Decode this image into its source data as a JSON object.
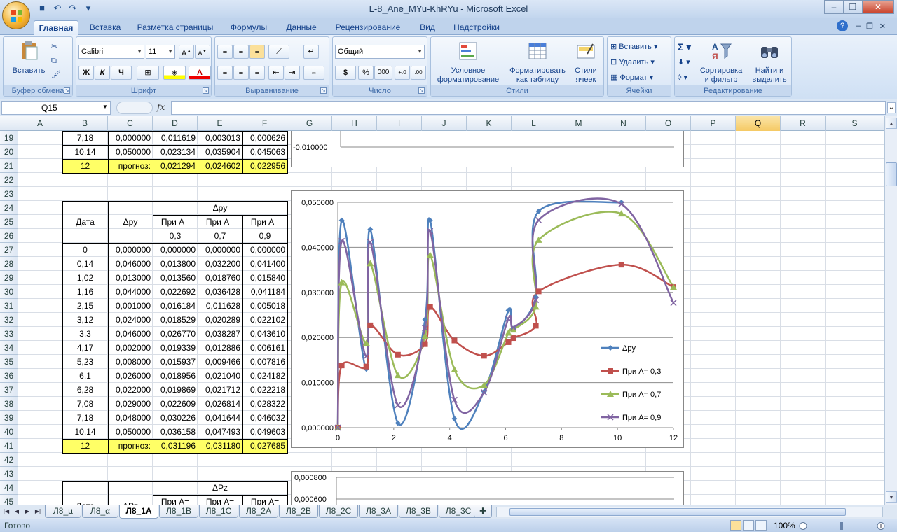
{
  "window": {
    "title": "L-8_Ane_MYu-KhRYu - Microsoft Excel"
  },
  "ribbon_tabs": [
    "Главная",
    "Вставка",
    "Разметка страницы",
    "Формулы",
    "Данные",
    "Рецензирование",
    "Вид",
    "Надстройки"
  ],
  "ribbon": {
    "clipboard": {
      "label": "Буфер обмена",
      "paste": "Вставить"
    },
    "font": {
      "label": "Шрифт",
      "name": "Calibri",
      "size": "11",
      "bold": "Ж",
      "italic": "К",
      "underline": "Ч"
    },
    "alignment": {
      "label": "Выравнивание"
    },
    "number": {
      "label": "Число",
      "format": "Общий",
      "currency": "$",
      "percent": "%",
      "thousands": "000"
    },
    "styles": {
      "label": "Стили",
      "conditional_1": "Условное",
      "conditional_2": "форматирование",
      "table_1": "Форматировать",
      "table_2": "как таблицу",
      "cell_1": "Стили",
      "cell_2": "ячеек"
    },
    "cells": {
      "label": "Ячейки",
      "insert": "Вставить",
      "delete": "Удалить",
      "format": "Формат"
    },
    "editing": {
      "label": "Редактирование",
      "sort_1": "Сортировка",
      "sort_2": "и фильтр",
      "find_1": "Найти и",
      "find_2": "выделить"
    }
  },
  "formula_bar": {
    "name_box": "Q15",
    "fx": "fx",
    "value": ""
  },
  "columns": [
    "A",
    "B",
    "C",
    "D",
    "E",
    "F",
    "G",
    "H",
    "I",
    "J",
    "K",
    "L",
    "M",
    "N",
    "O",
    "P",
    "Q",
    "R",
    "S"
  ],
  "rows": [
    "19",
    "20",
    "21",
    "22",
    "23",
    "24",
    "25",
    "26",
    "27",
    "28",
    "29",
    "30",
    "31",
    "32",
    "33",
    "34",
    "35",
    "36",
    "37",
    "38",
    "39",
    "40",
    "41",
    "42",
    "43",
    "44",
    "45"
  ],
  "top_table": {
    "rows": [
      [
        "7,18",
        "0,000000",
        "0,011619",
        "0,003013",
        "0,000626"
      ],
      [
        "10,14",
        "0,050000",
        "0,023134",
        "0,035904",
        "0,045063"
      ]
    ],
    "forecast": [
      "12",
      "прогноз:",
      "0,021294",
      "0,024602",
      "0,022956"
    ]
  },
  "table_py": {
    "h_date": "Дата",
    "h_delta": "Δpy",
    "h_group": "Δpy",
    "h_a1": "При А=",
    "h_a1v": "0,3",
    "h_a2": "При А=",
    "h_a2v": "0,7",
    "h_a3": "При А=",
    "h_a3v": "0,9",
    "rows": [
      [
        "0",
        "0,000000",
        "0,000000",
        "0,000000",
        "0,000000"
      ],
      [
        "0,14",
        "0,046000",
        "0,013800",
        "0,032200",
        "0,041400"
      ],
      [
        "1,02",
        "0,013000",
        "0,013560",
        "0,018760",
        "0,015840"
      ],
      [
        "1,16",
        "0,044000",
        "0,022692",
        "0,036428",
        "0,041184"
      ],
      [
        "2,15",
        "0,001000",
        "0,016184",
        "0,011628",
        "0,005018"
      ],
      [
        "3,12",
        "0,024000",
        "0,018529",
        "0,020289",
        "0,022102"
      ],
      [
        "3,3",
        "0,046000",
        "0,026770",
        "0,038287",
        "0,043610"
      ],
      [
        "4,17",
        "0,002000",
        "0,019339",
        "0,012886",
        "0,006161"
      ],
      [
        "5,23",
        "0,008000",
        "0,015937",
        "0,009466",
        "0,007816"
      ],
      [
        "6,1",
        "0,026000",
        "0,018956",
        "0,021040",
        "0,024182"
      ],
      [
        "6,28",
        "0,022000",
        "0,019869",
        "0,021712",
        "0,022218"
      ],
      [
        "7,08",
        "0,029000",
        "0,022609",
        "0,026814",
        "0,028322"
      ],
      [
        "7,18",
        "0,048000",
        "0,030226",
        "0,041644",
        "0,046032"
      ],
      [
        "10,14",
        "0,050000",
        "0,036158",
        "0,047493",
        "0,049603"
      ]
    ],
    "forecast": [
      "12",
      "прогноз:",
      "0,031196",
      "0,031180",
      "0,027685"
    ]
  },
  "table_pz": {
    "h_date": "Дата",
    "h_delta": "ΔPz",
    "h_group": "ΔPz",
    "h_a1": "При А=",
    "h_a2": "При А=",
    "h_a3": "При А="
  },
  "top_chart": {
    "tick": "-0,010000"
  },
  "bottom_chart": {
    "ticks": [
      "0,000800",
      "0,000600"
    ]
  },
  "chart_data": {
    "type": "scatter",
    "x": [
      0,
      0.14,
      1.02,
      1.16,
      2.15,
      3.12,
      3.3,
      4.17,
      5.23,
      6.1,
      6.28,
      7.08,
      7.18,
      10.14,
      12
    ],
    "series": [
      {
        "name": "Δpy",
        "color": "#4f81bd",
        "marker": "diamond",
        "values": [
          0,
          0.046,
          0.013,
          0.044,
          0.001,
          0.024,
          0.046,
          0.002,
          0.008,
          0.026,
          0.022,
          0.029,
          0.048,
          0.05,
          null
        ]
      },
      {
        "name": "При А= 0,3",
        "color": "#c0504d",
        "marker": "square",
        "values": [
          0,
          0.0138,
          0.01356,
          0.022692,
          0.016184,
          0.018529,
          0.02677,
          0.019339,
          0.015937,
          0.018956,
          0.019869,
          0.022609,
          0.030226,
          0.036158,
          0.031196
        ]
      },
      {
        "name": "При А= 0,7",
        "color": "#9bbb59",
        "marker": "triangle",
        "values": [
          0,
          0.0322,
          0.01876,
          0.036428,
          0.011628,
          0.020289,
          0.038287,
          0.012886,
          0.009466,
          0.02104,
          0.021712,
          0.026814,
          0.041644,
          0.047493,
          0.03118
        ]
      },
      {
        "name": "При А= 0,9",
        "color": "#8064a2",
        "marker": "x",
        "values": [
          0,
          0.0414,
          0.01584,
          0.041184,
          0.005018,
          0.022102,
          0.04361,
          0.006161,
          0.007816,
          0.024182,
          0.022218,
          0.028322,
          0.046032,
          0.049603,
          0.027685
        ]
      }
    ],
    "y_ticks": [
      "0,000000",
      "0,010000",
      "0,020000",
      "0,030000",
      "0,040000",
      "0,050000"
    ],
    "x_ticks": [
      "0",
      "2",
      "4",
      "6",
      "8",
      "10",
      "12"
    ],
    "xlim": [
      0,
      12
    ],
    "ylim": [
      0,
      0.05
    ],
    "grid": true,
    "legend": "right"
  },
  "sheet_tabs": [
    "Л8_µ",
    "Л8_α",
    "Л8_1А",
    "Л8_1В",
    "Л8_1С",
    "Л8_2А",
    "Л8_2В",
    "Л8_2С",
    "Л8_3А",
    "Л8_3В",
    "Л8_3С"
  ],
  "status": {
    "ready": "Готово",
    "zoom": "100%"
  }
}
